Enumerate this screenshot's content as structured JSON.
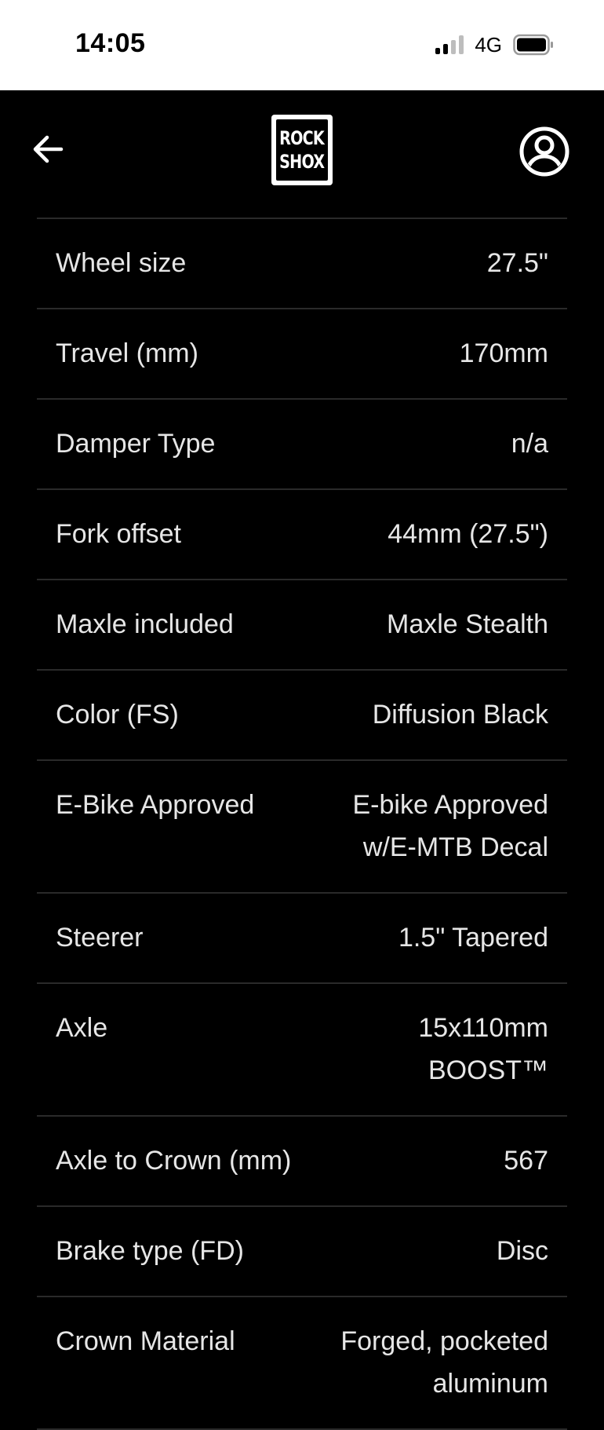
{
  "status_bar": {
    "time": "14:05",
    "network": "4G"
  },
  "header": {
    "logo_line1": "ROCK",
    "logo_line2": "SHOX"
  },
  "specs": [
    {
      "label": "Wheel size",
      "value": "27.5\""
    },
    {
      "label": "Travel (mm)",
      "value": "170mm"
    },
    {
      "label": "Damper Type",
      "value": "n/a"
    },
    {
      "label": "Fork offset",
      "value": "44mm (27.5\")"
    },
    {
      "label": "Maxle included",
      "value": "Maxle Stealth"
    },
    {
      "label": "Color (FS)",
      "value": "Diffusion Black"
    },
    {
      "label": "E-Bike Approved",
      "value": "E-bike Approved w/E-MTB Decal"
    },
    {
      "label": "Steerer",
      "value": "1.5\" Tapered"
    },
    {
      "label": "Axle",
      "value": "15x110mm BOOST™"
    },
    {
      "label": "Axle to Crown (mm)",
      "value": "567"
    },
    {
      "label": "Brake type (FD)",
      "value": "Disc"
    },
    {
      "label": "Crown Material",
      "value": "Forged, pocketed aluminum"
    }
  ]
}
